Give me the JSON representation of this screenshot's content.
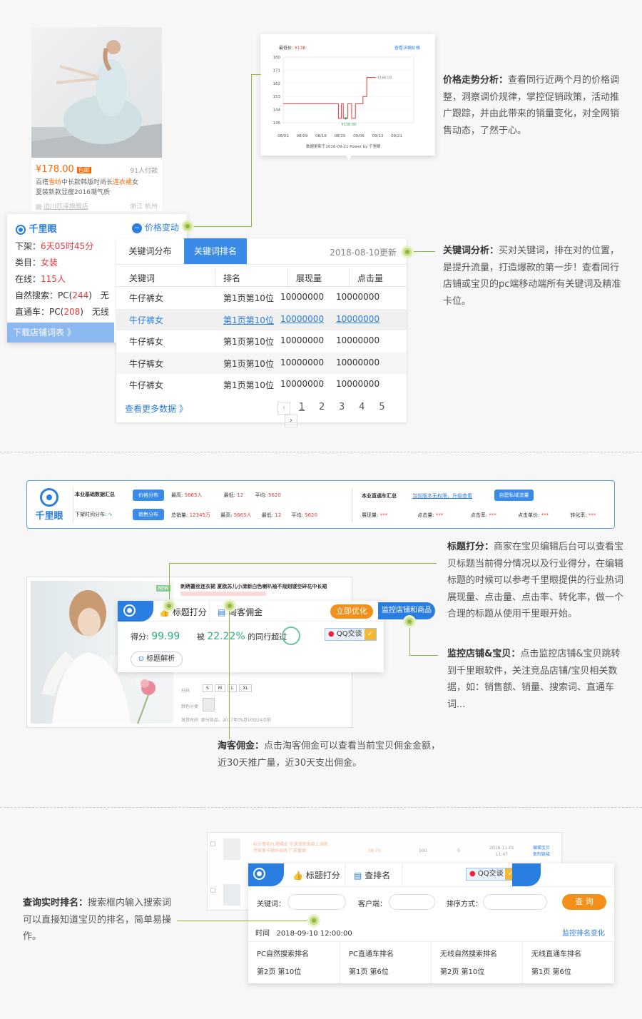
{
  "section1": {
    "product": {
      "price": "¥178.00",
      "price_badge": "包邮",
      "sales": "91人付款",
      "title_line1_a": "百搭",
      "title_line1_b": "雪纺",
      "title_line1_c": "中长款韩版时尚长",
      "title_line1_d": "连衣裙",
      "title_line1_e": "女",
      "title_line2": "夏装新款显瘦2016潮气质",
      "shop": "边川匹泽旗舰店",
      "location": "浙江 杭州"
    },
    "info_card": {
      "brand": "千里眼",
      "price_change": "价格变动",
      "rows": [
        {
          "label": "下架：",
          "value": "6天05时45分"
        },
        {
          "label": "类目：",
          "value": "女装"
        },
        {
          "label": "在线：",
          "value": "115人"
        },
        {
          "label": "自然搜索：PC(",
          "value": "244",
          "suffix": ")",
          "extra": "无"
        },
        {
          "label": "直通车：PC(",
          "value": "208",
          "suffix": ")",
          "extra": "无线"
        }
      ],
      "download": "下载店铺词表 》"
    },
    "price_chart": {
      "lowest_label": "最低价: ",
      "lowest_value": "¥138",
      "detail_link": "查看详细价格",
      "max_label": "¥166.00",
      "min_label": "¥138.00",
      "footer": "数据更新于2016-09-21 Power by 千里眼"
    },
    "keyword_panel": {
      "tab1": "关键词分布",
      "tab2": "关键词排名",
      "update": "2018-08-10更新",
      "headers": [
        "关键词",
        "排名",
        "展现量",
        "点击量"
      ],
      "rows": [
        [
          "牛仔裤女",
          "第1页第10位",
          "10000000",
          "10000000"
        ],
        [
          "牛仔裤女",
          "第1页第10位",
          "10000000",
          "10000000"
        ],
        [
          "牛仔裤女",
          "第1页第10位",
          "10000000",
          "10000000"
        ],
        [
          "牛仔裤女",
          "第1页第10位",
          "10000000",
          "10000000"
        ],
        [
          "牛仔裤女",
          "第1页第10位",
          "10000000",
          "10000000"
        ]
      ],
      "more": "查看更多数据 》",
      "pages": [
        "1",
        "2",
        "3",
        "4",
        "5"
      ]
    },
    "desc_price_title": "价格走势分析：",
    "desc_price_body": "查看同行近两个月的价格调整，洞察调价规律，掌控促销政策，活动推广跟踪，并由此带来的销量变化，对全网销售动态，了然于心。",
    "desc_kw_title": "关键词分析：",
    "desc_kw_body": "买对关键词，排在对的位置，是提升流量，打造爆款的第一步！查看同行店铺或宝贝的pc端移动端所有关键词及精准卡位。"
  },
  "section2": {
    "bar": {
      "brand": "千里眼",
      "summary_title": "本业基础数据汇总",
      "btn_price": "价格分布",
      "btn_sales": "销售分布",
      "shelf_dist": "下架时间分布:",
      "row1": [
        {
          "label": "最高:",
          "value": "5665人"
        },
        {
          "label": "最低:",
          "value": "12"
        },
        {
          "label": "平均:",
          "value": "5620"
        }
      ],
      "row2": [
        {
          "label": "总销量:",
          "value": "12345万"
        },
        {
          "label": "最高:",
          "value": "5665人"
        },
        {
          "label": "最低:",
          "value": "12"
        },
        {
          "label": "平均:",
          "value": "5620"
        }
      ],
      "ztc_title": "本业直通车汇总",
      "ztc_note": "当前版本无权限，升级查看",
      "ztc_btn": "自建私域流量",
      "ztc_items": [
        {
          "label": "展现量:",
          "value": "***"
        },
        {
          "label": "点击量:",
          "value": "***"
        },
        {
          "label": "点击率:",
          "value": "***"
        },
        {
          "label": "点击单价:",
          "value": "***"
        },
        {
          "label": "转化率:",
          "value": "***"
        }
      ]
    },
    "product": {
      "title": "刺绣蕾丝连衣裙 夏欧苏儿小清新白色喇叭袖不规则镂空碎花中长裙",
      "badge": "NEW",
      "sizes": [
        "S",
        "M",
        "L",
        "XL"
      ],
      "size_label": "尺码",
      "color_label": "颜色分类",
      "ship_label": "发货时间",
      "ship_value": "部分商品，2017年05月10日24点前"
    },
    "plugin": {
      "tab_score": "标题打分",
      "tab_tk": "淘客佣金",
      "optimize": "立即优化",
      "monitor": "监控店铺和商品",
      "score_label": "得分:",
      "score_value": "99.99",
      "exceed_prefix": "被",
      "exceed_value": "22.22%",
      "exceed_suffix": "的同行超过",
      "qq": "QQ交谈",
      "analysis": "标题解析"
    },
    "desc_title_t": "标题打分：",
    "desc_title_body": "商家在宝贝编辑后台可以查看宝贝标题当前得分情况以及行业得分，在编辑标题的时候可以参考千里眼提供的行业热词展现量、点击量、点击率、转化率，做一个合理的标题从使用千里眼开始。",
    "desc_monitor_t": "监控店铺&宝贝：",
    "desc_monitor_body": "点击监控店铺&宝贝跳转到千里眼软件，关注竞品店铺/宝贝相关数据，如：销售额、销量、搜索词、直通车词...",
    "desc_tk_t": "淘客佣金：",
    "desc_tk_body1": "点击淘客佣金可以查看当前宝贝佣金金额，",
    "desc_tk_body2": "近30天推广量，近30天支出佣金。"
  },
  "section3": {
    "bg_row": {
      "line1": "标乐慢毛PL橙橘女 乐荣淑练练款上调练",
      "line2": "坏家衷卡姆纤丝线 广家番锦",
      "price": "38.70",
      "col1": "100",
      "col2": "0",
      "date": "2016-11-01",
      "time": "11:47",
      "act1": "编辑宝贝",
      "act2": "复制链接"
    },
    "plugin": {
      "tab_score": "标题打分",
      "tab_rank": "查排名",
      "qq": "QQ交谈",
      "kw_label": "关键词：",
      "client_label": "客户端：",
      "sort_label": "排序方式：",
      "query": "查 询",
      "time_label": "时间",
      "time_value": "2018-09-10 12:00:00",
      "monitor_change": "监控排名变化",
      "cols": [
        {
          "title": "PC自然搜索排名",
          "value": "第2页 第10位"
        },
        {
          "title": "PC直通车排名",
          "value": "第1页 第6位"
        },
        {
          "title": "无线自然搜索排名",
          "value": "第2页 第10位"
        },
        {
          "title": "无线直通车排名",
          "value": "第1页 第6位"
        }
      ]
    },
    "desc_t": "查询实时排名：",
    "desc_body": "搜索框内输入搜索词可以直接知道宝贝的排名，简单易操作。"
  },
  "chart_data": {
    "type": "line",
    "title": "",
    "xlabel": "",
    "ylabel": "",
    "x": [
      "08/01",
      "08/09",
      "08/18",
      "08/25",
      "09/06",
      "09/13",
      "09/21"
    ],
    "y_ticks": [
      180,
      171,
      162,
      153,
      144,
      135
    ],
    "ylim": [
      135,
      180
    ],
    "series": [
      {
        "name": "",
        "points": [
          [
            0,
            148
          ],
          [
            0.35,
            148
          ],
          [
            0.4,
            148
          ],
          [
            0.45,
            148
          ],
          [
            0.55,
            148
          ],
          [
            0.6,
            148
          ],
          [
            0.7,
            148
          ],
          [
            0.75,
            148
          ],
          [
            0.85,
            148
          ],
          [
            1.0,
            148
          ],
          [
            1.05,
            148
          ],
          [
            1.12,
            148
          ],
          [
            1.2,
            148
          ],
          [
            1.25,
            148
          ],
          [
            1.5,
            148
          ],
          [
            1.8,
            148
          ],
          [
            2.2,
            148
          ],
          [
            2.6,
            148
          ],
          [
            2.92,
            148
          ],
          [
            2.92,
            138
          ],
          [
            3.08,
            138
          ],
          [
            3.08,
            148
          ],
          [
            3.18,
            148
          ],
          [
            3.18,
            138
          ],
          [
            3.42,
            138
          ],
          [
            3.42,
            148
          ],
          [
            3.62,
            148
          ],
          [
            3.62,
            138
          ],
          [
            3.82,
            138
          ],
          [
            3.82,
            148
          ],
          [
            4.0,
            148
          ],
          [
            4.22,
            148
          ],
          [
            4.22,
            153
          ],
          [
            4.42,
            153
          ],
          [
            4.42,
            166
          ],
          [
            4.9,
            166
          ]
        ]
      }
    ],
    "annotations": [
      "¥166.00",
      "¥138.00"
    ]
  }
}
